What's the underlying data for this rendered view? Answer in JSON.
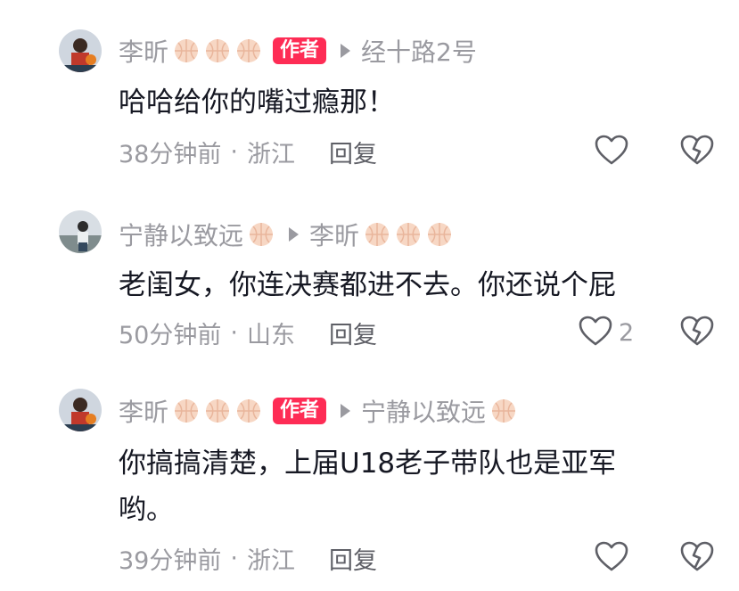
{
  "comments": [
    {
      "author": "李昕",
      "is_author": true,
      "badge": "作者",
      "reply_to": "经十路2号",
      "text": "哈哈给你的嘴过瘾那！",
      "time": "38分钟前",
      "location": "浙江",
      "reply_label": "回复",
      "likes": ""
    },
    {
      "author": "宁静以致远",
      "is_author": false,
      "badge": "",
      "reply_to": "李昕",
      "text": "老闺女，你连决赛都进不去。你还说个屁",
      "time": "50分钟前",
      "location": "山东",
      "reply_label": "回复",
      "likes": "2"
    },
    {
      "author": "李昕",
      "is_author": true,
      "badge": "作者",
      "reply_to": "宁静以致远",
      "text": "你搞搞清楚，上届U18老子带队也是亚军哟。",
      "time": "39分钟前",
      "location": "浙江",
      "reply_label": "回复",
      "likes": ""
    }
  ],
  "separator": "·",
  "icons": {
    "like": "heart-outline-icon",
    "dislike": "broken-heart-icon",
    "emoji": "basketball-emoji-icon",
    "reply_arrow": "play-arrow-icon"
  },
  "colors": {
    "badge": "#fe2c55",
    "muted": "#9a9aa0",
    "text": "#161823"
  }
}
